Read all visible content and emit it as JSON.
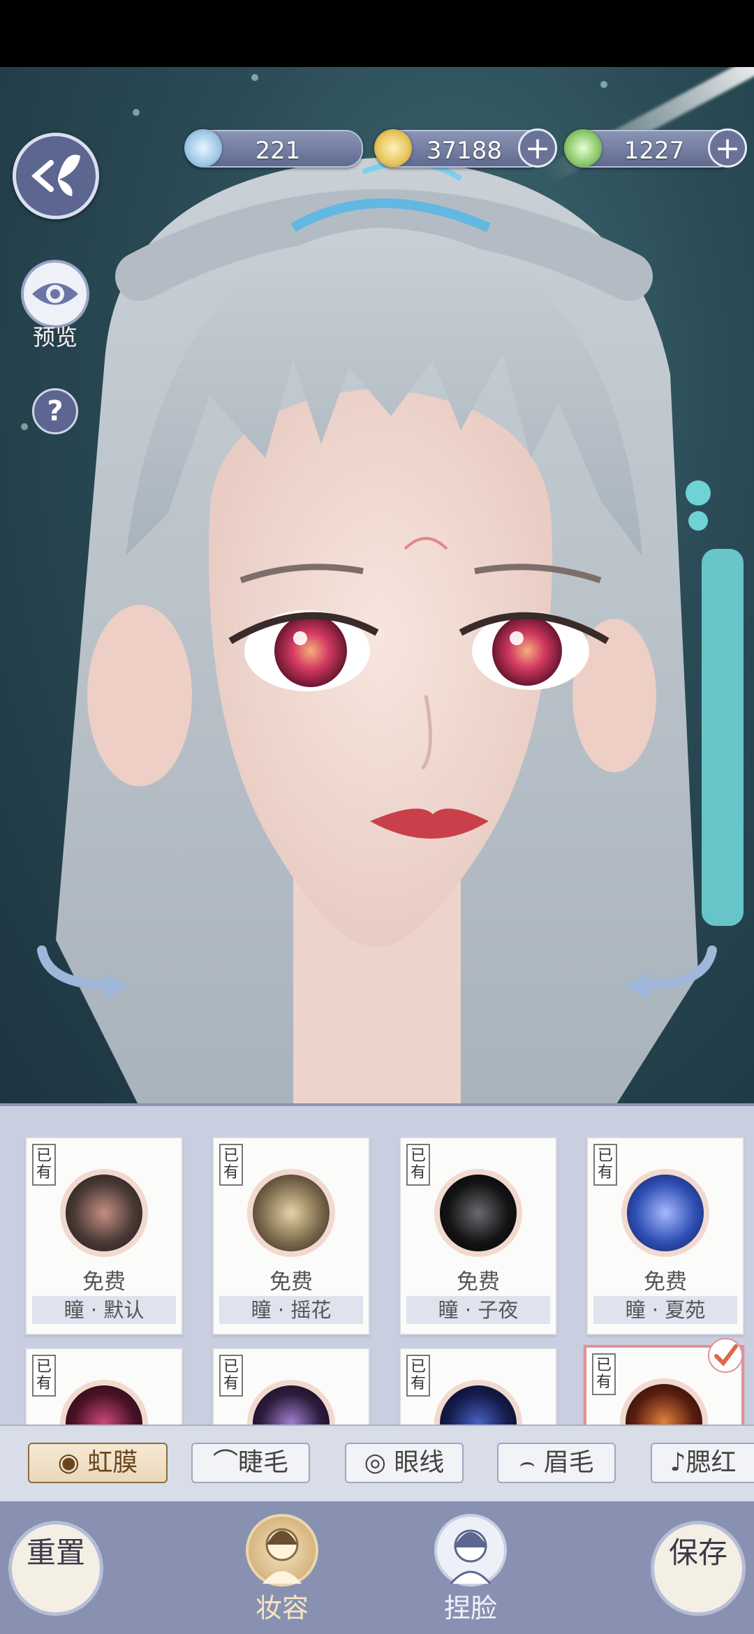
{
  "resources": [
    {
      "name": "jade",
      "value": "221",
      "color": "#9ec8e6",
      "has_plus": false
    },
    {
      "name": "coin",
      "value": "37188",
      "color": "#e7c35a",
      "has_plus": true
    },
    {
      "name": "token",
      "value": "1227",
      "color": "#8bc86a",
      "has_plus": true
    }
  ],
  "side": {
    "preview_label": "预览",
    "help_label": "?"
  },
  "owned_tag": "已有",
  "irises": [
    {
      "price": "免费",
      "name": "瞳 · 默认",
      "color": "#4a3a36"
    },
    {
      "price": "免费",
      "name": "瞳 · 摇花",
      "color": "#7b6a4c"
    },
    {
      "price": "免费",
      "name": "瞳 · 子夜",
      "color": "#141416"
    },
    {
      "price": "免费",
      "name": "瞳 · 夏苑",
      "color": "#2f4fb4"
    },
    {
      "price": "",
      "name": "",
      "color": "#4a1326"
    },
    {
      "price": "",
      "name": "",
      "color": "#2d1c3c"
    },
    {
      "price": "",
      "name": "",
      "color": "#141c4a"
    },
    {
      "price": "",
      "name": "",
      "color": "#5a1e10"
    }
  ],
  "selected_index": 7,
  "tabs": [
    {
      "label": "虹膜",
      "icon": "iris-icon",
      "active": true
    },
    {
      "label": "睫毛",
      "icon": "eyelash-icon",
      "active": false
    },
    {
      "label": "眼线",
      "icon": "eye-icon",
      "active": false
    },
    {
      "label": "眉毛",
      "icon": "brow-icon",
      "active": false
    },
    {
      "label": "腮红",
      "icon": "blush-icon",
      "active": false
    }
  ],
  "bottom": {
    "reset": "重置",
    "makeup": "妆容",
    "face": "捏脸",
    "save": "保存"
  },
  "colors": {
    "accent": "#8b6b3e",
    "panel": "#c9cfe0",
    "nav": "#8991b2",
    "selected": "#e48f97"
  }
}
